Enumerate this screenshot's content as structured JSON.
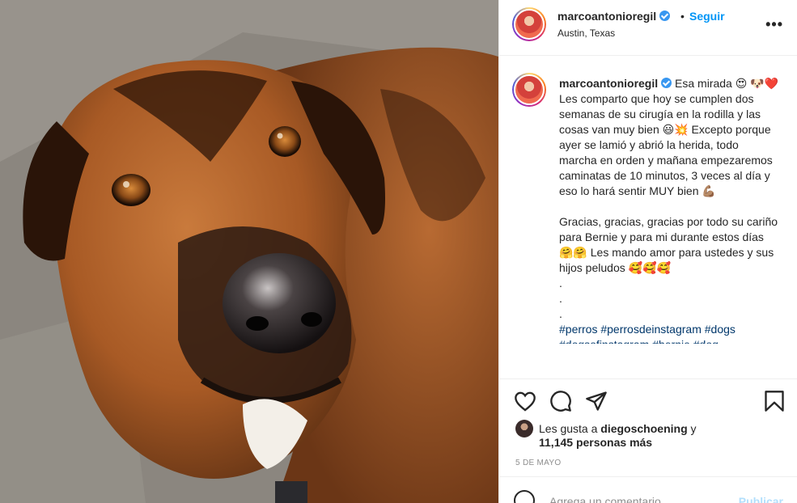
{
  "post": {
    "username": "marcoantonioregil",
    "verified": true,
    "separator": "•",
    "follow_label": "Seguir",
    "location": "Austin, Texas",
    "more_label": "•••",
    "image_subject": "dog-photo"
  },
  "caption": {
    "username": "marcoantonioregil",
    "line1": "Esa mirada 😍",
    "line2": "🐶❤️ Les comparto que hoy se cumplen dos semanas de su cirugía en la rodilla y las cosas van muy bien 😃💥 Excepto porque ayer se lamió y abrió la herida, todo marcha en orden y mañana empezaremos caminatas de 10 minutos, 3 veces al día y eso lo hará sentir MUY bien 💪🏽",
    "line3": "Gracias, gracias, gracias por todo su cariño para Bernie y para mi durante estos días 🤗🤗 Les mando amor para ustedes y sus hijos peludos 🥰🥰🥰",
    "dot1": ".",
    "dot2": ".",
    "dot3": ".",
    "hashtags": "#perros #perrosdeinstagram #dogs",
    "hashtags_cut": "#dogsofinstagram #bernie #dog"
  },
  "actions": {
    "like_icon": "heart-icon",
    "comment_icon": "comment-icon",
    "share_icon": "paper-plane-icon",
    "save_icon": "bookmark-icon"
  },
  "likes": {
    "prefix": "Les gusta a ",
    "liker": "diegoschoening",
    "suffix": " y",
    "others": "11,145 personas más"
  },
  "date": "5 DE MAYO",
  "comment_box": {
    "placeholder": "Agrega un comentario...",
    "publish_label": "Publicar"
  },
  "colors": {
    "link_blue": "#0095f6",
    "hashtag": "#00376b",
    "publish_disabled": "#b2dffc",
    "verified": "#3897f0"
  }
}
